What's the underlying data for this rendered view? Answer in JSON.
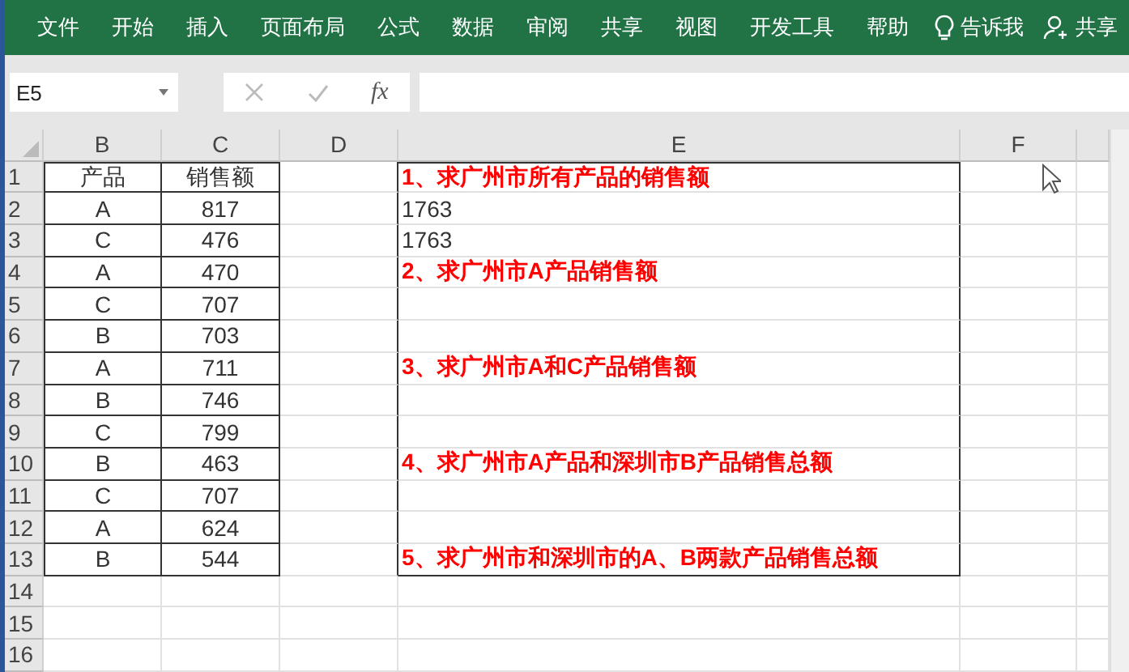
{
  "ribbon": {
    "tabs": [
      "文件",
      "开始",
      "插入",
      "页面布局",
      "公式",
      "数据",
      "审阅",
      "共享",
      "视图",
      "开发工具",
      "帮助"
    ],
    "tell_me": "告诉我",
    "share": "共享"
  },
  "formula_bar": {
    "name_box": "E5",
    "fx": "fx"
  },
  "columns": [
    "B",
    "C",
    "D",
    "E",
    "F"
  ],
  "rows": [
    {
      "number": "1",
      "b": "产品",
      "c": "销售额",
      "e": {
        "kind": "question",
        "text": "1、求广州市所有产品的销售额"
      }
    },
    {
      "number": "2",
      "b": "A",
      "c": "817",
      "e": {
        "kind": "value",
        "text": "1763"
      }
    },
    {
      "number": "3",
      "b": "C",
      "c": "476",
      "e": {
        "kind": "value",
        "text": "1763"
      }
    },
    {
      "number": "4",
      "b": "A",
      "c": "470",
      "e": {
        "kind": "question",
        "text": "2、求广州市A产品销售额"
      }
    },
    {
      "number": "5",
      "b": "C",
      "c": "707"
    },
    {
      "number": "6",
      "b": "B",
      "c": "703"
    },
    {
      "number": "7",
      "b": "A",
      "c": "711",
      "e": {
        "kind": "question",
        "text": "3、求广州市A和C产品销售额"
      }
    },
    {
      "number": "8",
      "b": "B",
      "c": "746"
    },
    {
      "number": "9",
      "b": "C",
      "c": "799"
    },
    {
      "number": "10",
      "b": "B",
      "c": "463",
      "e": {
        "kind": "question",
        "text": "4、求广州市A产品和深圳市B产品销售总额"
      }
    },
    {
      "number": "11",
      "b": "C",
      "c": "707"
    },
    {
      "number": "12",
      "b": "A",
      "c": "624"
    },
    {
      "number": "13",
      "b": "B",
      "c": "544",
      "e": {
        "kind": "question",
        "text": "5、求广州市和深圳市的A、B两款产品销售总额"
      }
    },
    {
      "number": "14"
    },
    {
      "number": "15"
    },
    {
      "number": "16"
    }
  ]
}
